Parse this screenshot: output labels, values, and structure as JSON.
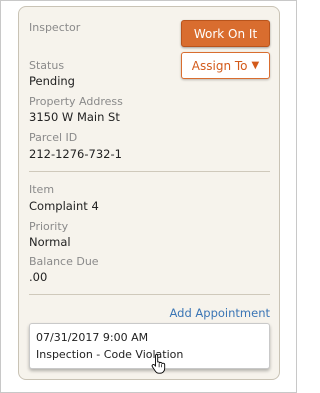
{
  "card": {
    "header_label": "Inspector",
    "status": {
      "label": "Status",
      "value": "Pending"
    },
    "property_address": {
      "label": "Property Address",
      "value": "3150 W Main St"
    },
    "parcel_id": {
      "label": "Parcel ID",
      "value": "212-1276-732-1"
    },
    "item": {
      "label": "Item",
      "value": "Complaint 4"
    },
    "priority": {
      "label": "Priority",
      "value": "Normal"
    },
    "balance_due": {
      "label": "Balance Due",
      "value": ".00"
    }
  },
  "actions": {
    "work_on_it_label": "Work On It",
    "assign_to_label": "Assign To",
    "assign_to_icon": "caret-down-icon",
    "primary_color": "#d96d2f"
  },
  "appointments": {
    "add_label": "Add Appointment",
    "items": [
      {
        "datetime": "07/31/2017 9:00 AM",
        "description": "Inspection - Code Violation"
      }
    ]
  },
  "colors": {
    "card_background": "#f6f3ec",
    "link": "#3a75b5"
  }
}
